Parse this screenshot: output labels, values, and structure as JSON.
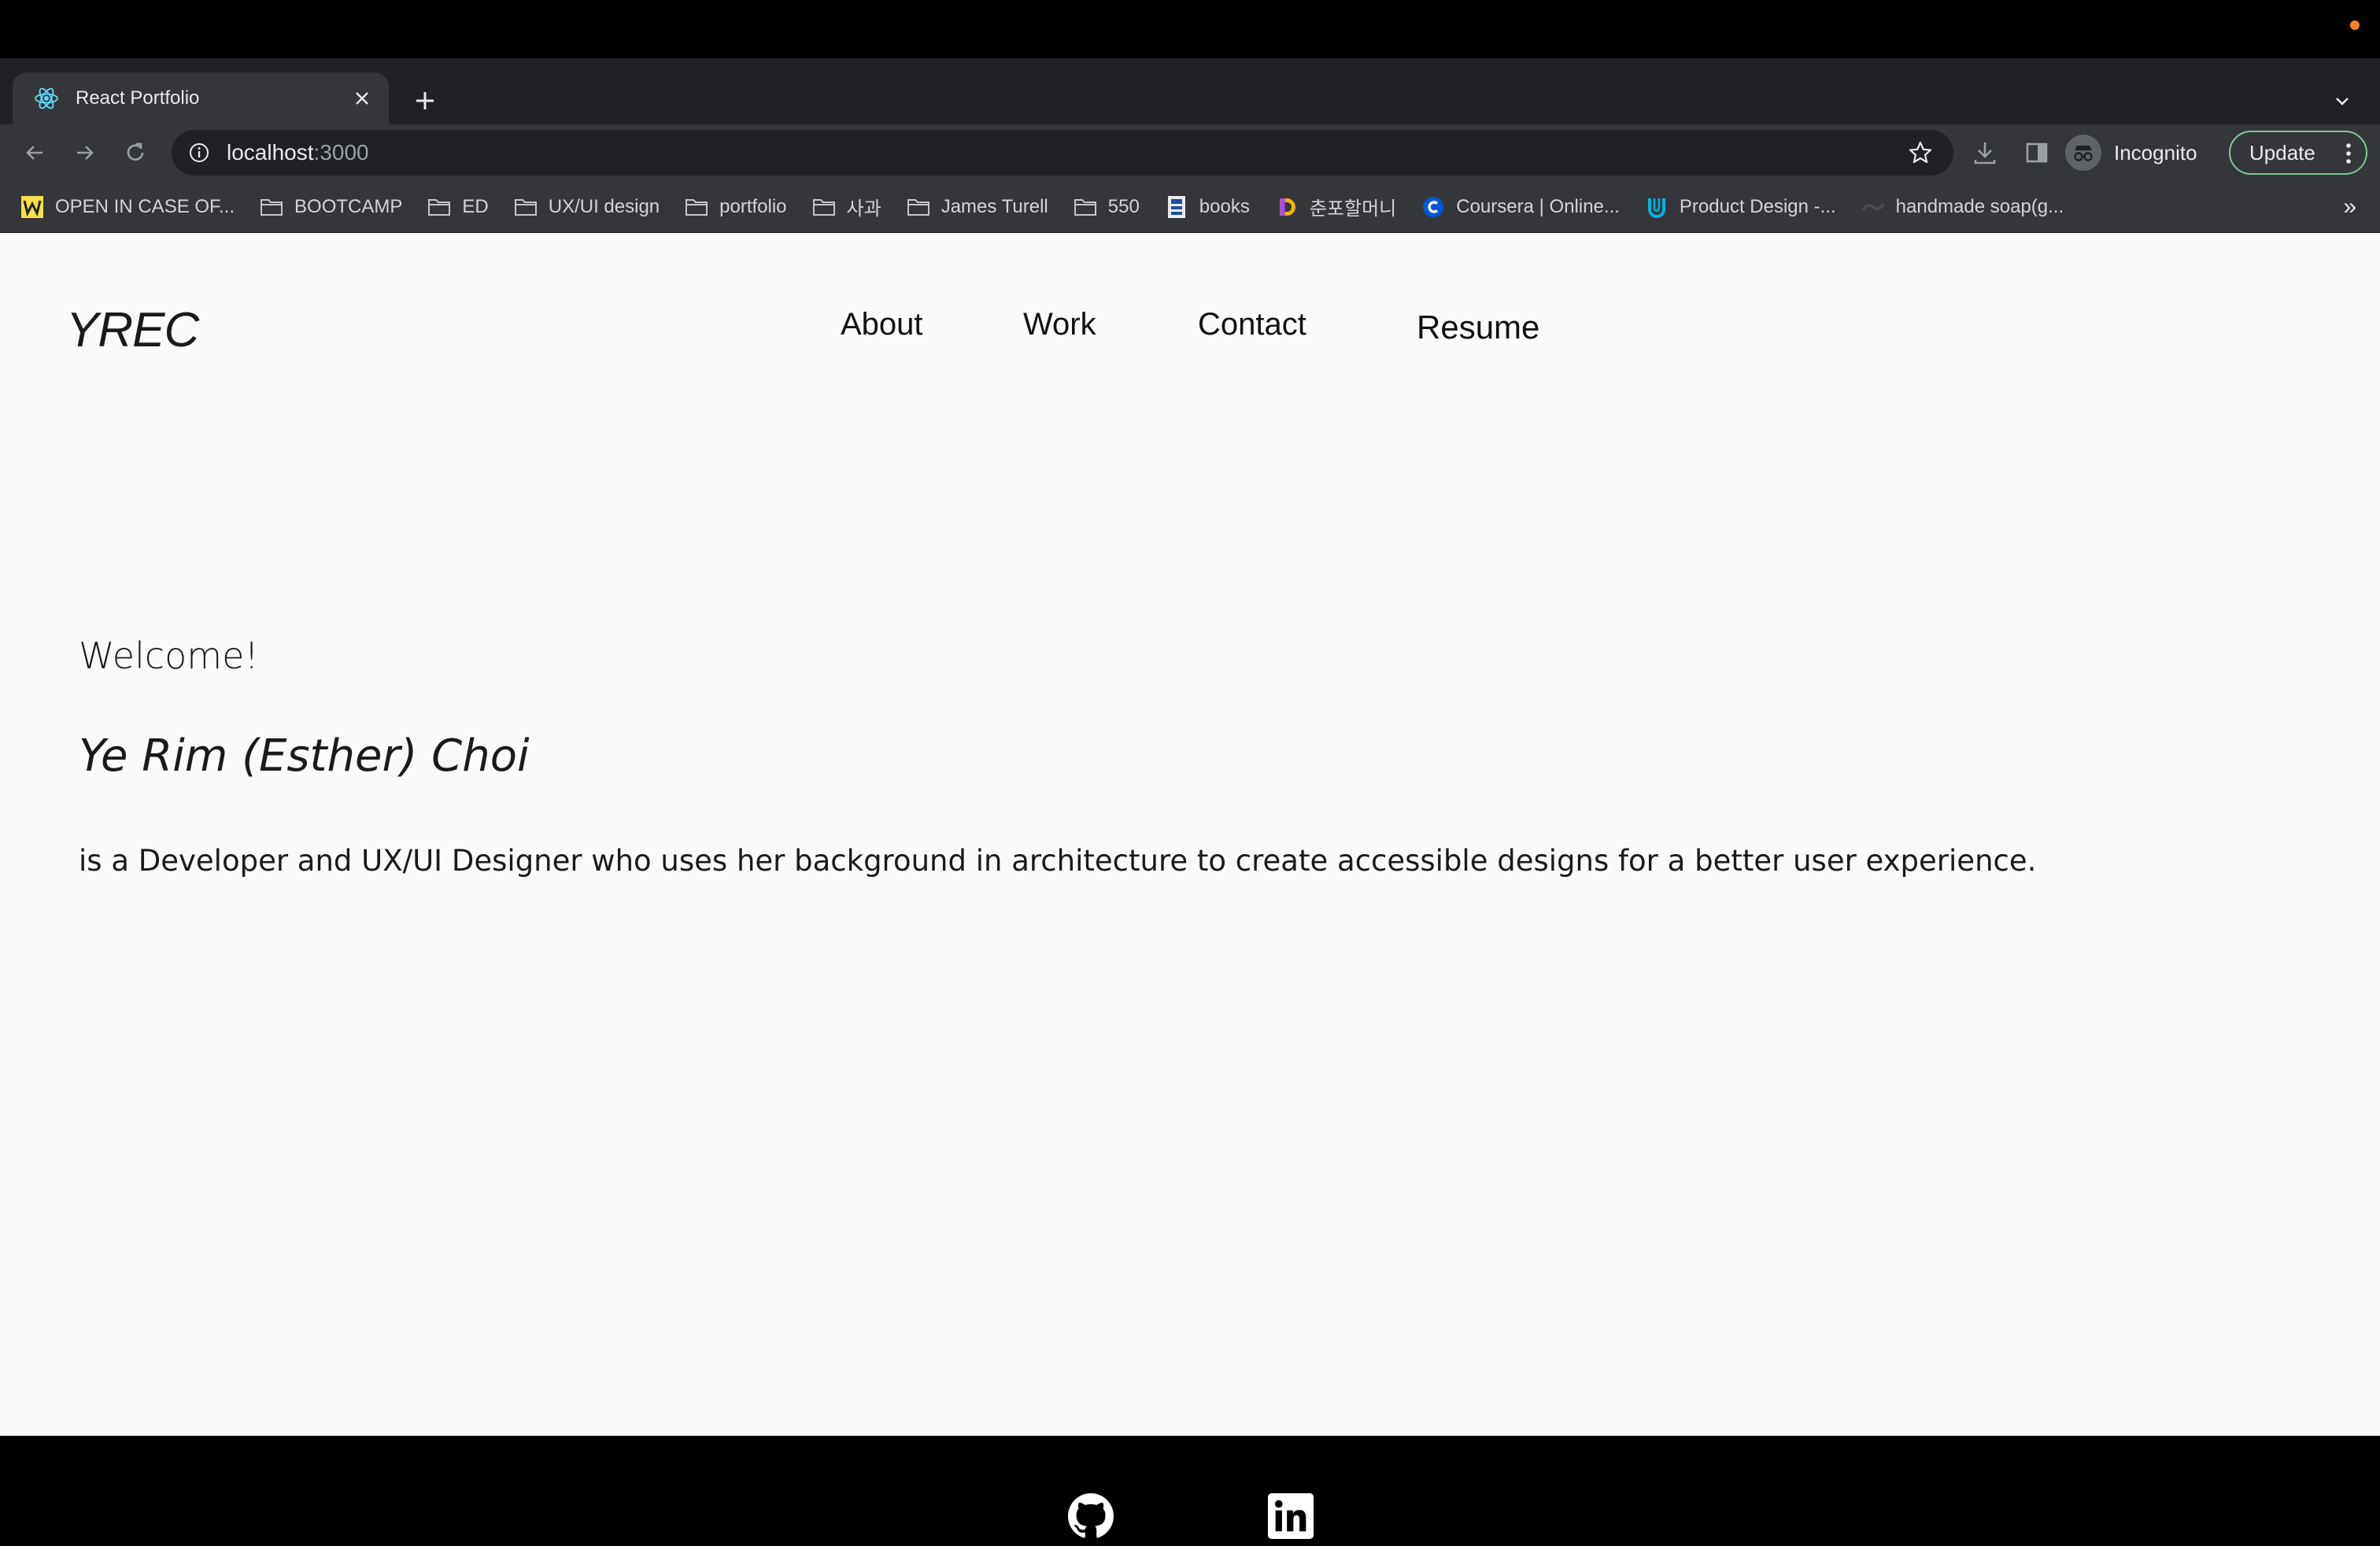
{
  "browser": {
    "tab": {
      "title": "React Portfolio",
      "favicon": "react-icon"
    },
    "url": {
      "host": "localhost",
      "port": ":3000"
    },
    "profile_label": "Incognito",
    "update_label": "Update",
    "bookmarks": [
      {
        "label": "OPEN IN CASE OF...",
        "icon": "favicon-w"
      },
      {
        "label": "BOOTCAMP",
        "icon": "folder-icon"
      },
      {
        "label": "ED",
        "icon": "folder-icon"
      },
      {
        "label": "UX/UI design",
        "icon": "folder-icon"
      },
      {
        "label": "portfolio",
        "icon": "folder-icon"
      },
      {
        "label": "사과",
        "icon": "folder-icon"
      },
      {
        "label": "James Turell",
        "icon": "folder-icon"
      },
      {
        "label": "550",
        "icon": "folder-icon"
      },
      {
        "label": "books",
        "icon": "books-favicon"
      },
      {
        "label": "춘포할머니",
        "icon": "d-favicon"
      },
      {
        "label": "Coursera | Online...",
        "icon": "coursera-favicon"
      },
      {
        "label": "Product Design -...",
        "icon": "u-favicon"
      },
      {
        "label": "handmade soap(g...",
        "icon": "soap-favicon"
      }
    ],
    "bookmarks_overflow": "»"
  },
  "site": {
    "logo": "YREC",
    "nav": [
      "About",
      "Work",
      "Contact",
      "Resume"
    ],
    "hero": {
      "greeting": "Welcome!",
      "name": "Ye Rim (Esther) Choi",
      "bio": "is a Developer and UX/UI Designer who uses her background in architecture to create accessible designs for a better user experience."
    },
    "footer_links": [
      "github-icon",
      "linkedin-icon"
    ]
  },
  "colors": {
    "page_bg": "#fafaf8",
    "chrome_dark": "#202124",
    "chrome_toolbar": "#35363a",
    "footer_bg": "#000000",
    "update_border": "#81c995",
    "status_dot": "#f5821f"
  }
}
